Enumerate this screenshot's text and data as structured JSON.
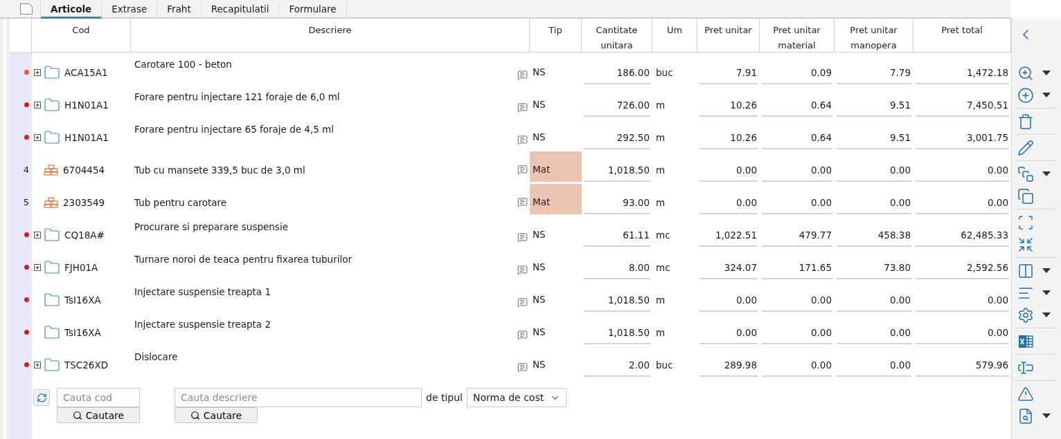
{
  "tabs": [
    {
      "kind": "icon",
      "selected": false
    },
    {
      "kind": "text",
      "label": "Articole",
      "selected": true
    },
    {
      "kind": "text",
      "label": "Extrase",
      "selected": false
    },
    {
      "kind": "text",
      "label": "Fraht",
      "selected": false
    },
    {
      "kind": "text",
      "label": "Recapitulatii",
      "selected": false
    },
    {
      "kind": "text",
      "label": "Formulare",
      "selected": false
    }
  ],
  "table": {
    "columns": [
      "Cod",
      "Descriere",
      "Tip",
      "Cantitate unitara",
      "Um",
      "Pret unitar",
      "Pret unitar material",
      "Pret unitar manopera",
      "Pret total"
    ],
    "rows": [
      {
        "kind": "article",
        "color": "#e8612c",
        "expandable": true,
        "cod": "ACA15A1",
        "descriere": "Carotare 100 - beton",
        "tip": "NS",
        "cantitate": "186.00",
        "um": "buc",
        "pret_unitar": "7.91",
        "pret_material": "0.09",
        "pret_manopera": "7.79",
        "pret_total": "1,472.18"
      },
      {
        "kind": "article",
        "color": "#c8202c",
        "expandable": true,
        "cod": "H1N01A1",
        "descriere": "Forare pentru injectare 121 foraje de 6,0 ml",
        "tip": "NS",
        "cantitate": "726.00",
        "um": "m",
        "pret_unitar": "10.26",
        "pret_material": "0.64",
        "pret_manopera": "9.51",
        "pret_total": "7,450.51"
      },
      {
        "kind": "article",
        "color": "#c8202c",
        "expandable": true,
        "cod": "H1N01A1",
        "descriere": "Forare pentru injectare 65 foraje de 4,5 ml",
        "tip": "NS",
        "cantitate": "292.50",
        "um": "m",
        "pret_unitar": "10.26",
        "pret_material": "0.64",
        "pret_manopera": "9.51",
        "pret_total": "3,001.75"
      },
      {
        "kind": "material",
        "marker": "4",
        "expandable": false,
        "cod": "6704454",
        "descriere": "Tub cu mansete 339,5 buc de 3,0 ml",
        "tip": "Mat",
        "cantitate": "1,018.50",
        "um": "m",
        "pret_unitar": "0.00",
        "pret_material": "0.00",
        "pret_manopera": "0.00",
        "pret_total": "0.00"
      },
      {
        "kind": "material",
        "marker": "5",
        "expandable": false,
        "cod": "2303549",
        "descriere": "Tub pentru carotare",
        "tip": "Mat",
        "cantitate": "93.00",
        "um": "m",
        "pret_unitar": "0.00",
        "pret_material": "0.00",
        "pret_manopera": "0.00",
        "pret_total": "0.00"
      },
      {
        "kind": "article",
        "color": "#c8202c",
        "expandable": true,
        "cod": "CQ18A#",
        "descriere": "Procurare si preparare suspensie",
        "tip": "NS",
        "cantitate": "61.11",
        "um": "mc",
        "pret_unitar": "1,022.51",
        "pret_material": "479.77",
        "pret_manopera": "458.38",
        "pret_total": "62,485.33"
      },
      {
        "kind": "article",
        "color": "#c8202c",
        "expandable": true,
        "cod": "FJH01A",
        "descriere": "Turnare noroi de teaca pentru fixarea tuburilor",
        "tip": "NS",
        "cantitate": "8.00",
        "um": "mc",
        "pret_unitar": "324.07",
        "pret_material": "171.65",
        "pret_manopera": "73.80",
        "pret_total": "2,592.56"
      },
      {
        "kind": "article",
        "color": "#c8202c",
        "expandable": false,
        "cod": "TsI16XA",
        "descriere": "Injectare suspensie treapta 1",
        "tip": "NS",
        "cantitate": "1,018.50",
        "um": "m",
        "pret_unitar": "0.00",
        "pret_material": "0.00",
        "pret_manopera": "0.00",
        "pret_total": "0.00"
      },
      {
        "kind": "article",
        "color": "#c8202c",
        "expandable": false,
        "cod": "TsI16XA",
        "descriere": "Injectare suspensie treapta 2",
        "tip": "NS",
        "cantitate": "1,018.50",
        "um": "m",
        "pret_unitar": "0.00",
        "pret_material": "0.00",
        "pret_manopera": "0.00",
        "pret_total": "0.00"
      },
      {
        "kind": "article",
        "color": "#c8202c",
        "expandable": true,
        "cod": "TSC26XD",
        "descriere": "Dislocare",
        "tip": "NS",
        "cantitate": "2.00",
        "um": "buc",
        "pret_unitar": "289.98",
        "pret_material": "0.00",
        "pret_manopera": "0.00",
        "pret_total": "579.96"
      }
    ]
  },
  "search": {
    "code_placeholder": "Cauta cod",
    "code_button": "Cautare",
    "description_placeholder": "Cauta descriere",
    "description_button": "Cautare",
    "type_label": "de tipul",
    "type_value": "Norma de cost"
  },
  "toolbar": [
    [
      {
        "kind": "back",
        "dropdown": false
      }
    ],
    [
      {
        "kind": "zoom",
        "dropdown": true
      },
      {
        "kind": "add",
        "dropdown": true
      }
    ],
    [
      {
        "kind": "delete",
        "dropdown": false
      }
    ],
    [
      {
        "kind": "edit",
        "dropdown": false
      }
    ],
    [
      {
        "kind": "copy-framed",
        "dropdown": true
      },
      {
        "kind": "copy",
        "dropdown": false
      }
    ],
    [
      {
        "kind": "expand",
        "dropdown": false
      },
      {
        "kind": "collapse",
        "dropdown": false
      }
    ],
    [
      {
        "kind": "panel",
        "dropdown": true
      },
      {
        "kind": "rows",
        "dropdown": true
      },
      {
        "kind": "settings",
        "dropdown": true
      }
    ],
    [
      {
        "kind": "excel",
        "dropdown": false
      }
    ],
    [
      {
        "kind": "rename",
        "dropdown": false
      }
    ],
    [
      {
        "kind": "warning",
        "dropdown": false
      },
      {
        "kind": "preview",
        "dropdown": true
      }
    ]
  ]
}
